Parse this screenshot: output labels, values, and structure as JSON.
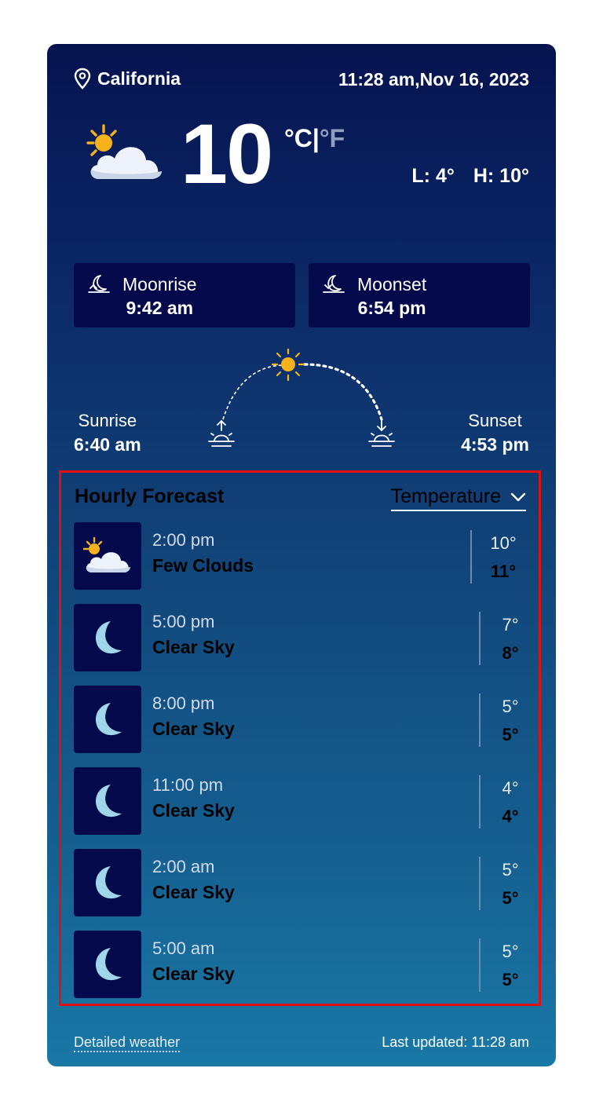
{
  "header": {
    "location": "California",
    "datetime": "11:28 am,Nov 16, 2023"
  },
  "current": {
    "temperature": "10",
    "unit_c": "°C",
    "unit_sep": "|",
    "unit_f": "°F",
    "low": "L: 4°",
    "high": "H: 10°",
    "icon": "sun-cloud-icon"
  },
  "moon": {
    "moonrise_label": "Moonrise",
    "moonrise_time": "9:42 am",
    "moonset_label": "Moonset",
    "moonset_time": "6:54 pm"
  },
  "sun": {
    "sunrise_label": "Sunrise",
    "sunrise_time": "6:40 am",
    "sunset_label": "Sunset",
    "sunset_time": "4:53 pm"
  },
  "hourly": {
    "title": "Hourly Forecast",
    "selector": "Temperature",
    "rows": [
      {
        "time": "2:00 pm",
        "condition": "Few Clouds",
        "high": "10°",
        "low": "11°",
        "icon": "sun-cloud-icon"
      },
      {
        "time": "5:00 pm",
        "condition": "Clear Sky",
        "high": "7°",
        "low": "8°",
        "icon": "moon-icon"
      },
      {
        "time": "8:00 pm",
        "condition": "Clear Sky",
        "high": "5°",
        "low": "5°",
        "icon": "moon-icon"
      },
      {
        "time": "11:00 pm",
        "condition": "Clear Sky",
        "high": "4°",
        "low": "4°",
        "icon": "moon-icon"
      },
      {
        "time": "2:00 am",
        "condition": "Clear Sky",
        "high": "5°",
        "low": "5°",
        "icon": "moon-icon"
      },
      {
        "time": "5:00 am",
        "condition": "Clear Sky",
        "high": "5°",
        "low": "5°",
        "icon": "moon-icon"
      }
    ]
  },
  "footer": {
    "detailed_link": "Detailed weather",
    "last_updated": "Last updated: 11:28 am"
  },
  "colors": {
    "card_top": "#06134f",
    "card_bottom": "#1978a6",
    "tile": "#03094a",
    "highlight_border": "#e01010",
    "sun": "#f6b21b",
    "moon": "#9fd6ea"
  }
}
